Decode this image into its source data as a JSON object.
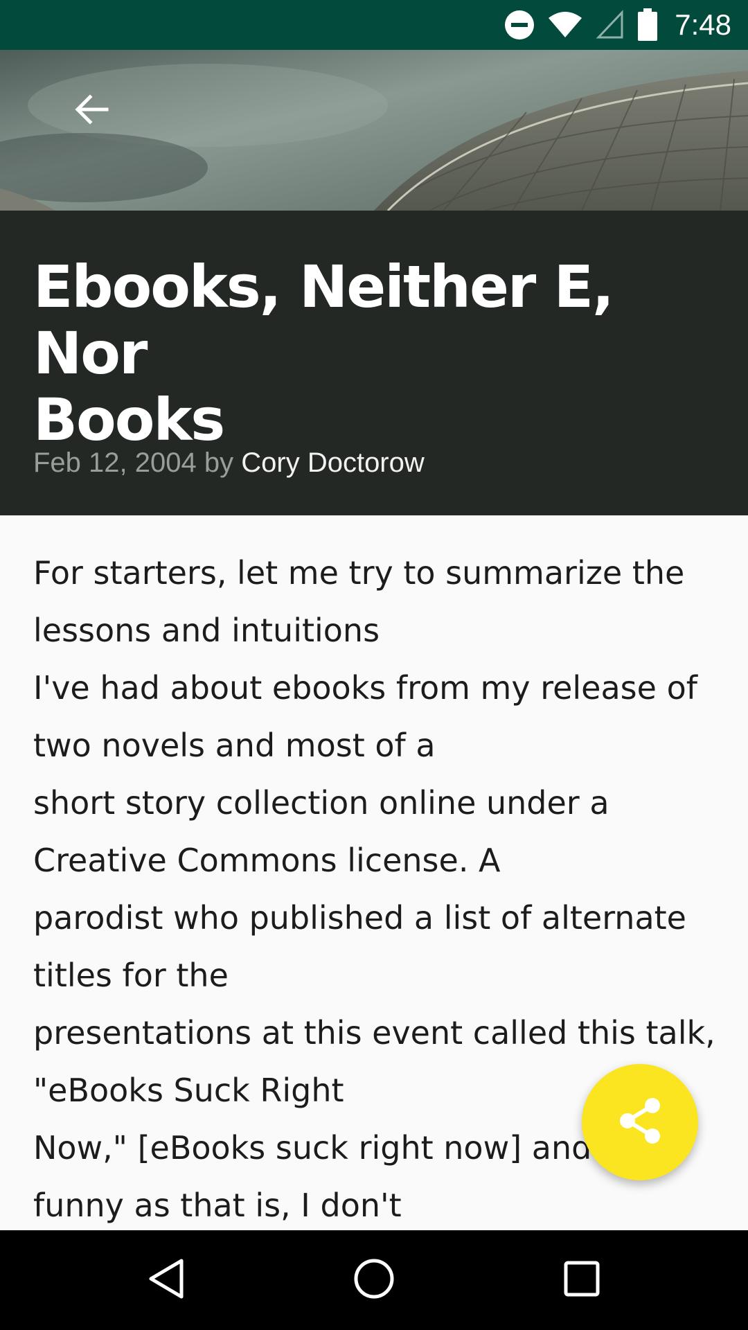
{
  "status_bar": {
    "time": "7:48",
    "background": "#024a3c",
    "icons": [
      "do-not-disturb-icon",
      "wifi-icon",
      "cell-signal-icon",
      "battery-icon"
    ]
  },
  "toolbar": {
    "back_icon": "arrow-back-icon"
  },
  "article": {
    "title_line1": "Ebooks, Neither E, Nor",
    "title_line2": "Books",
    "date": "Feb 12, 2004",
    "by": "by",
    "author": "Cory Doctorow",
    "body_lines": [
      "For starters, let me try to summarize the",
      "lessons and intuitions",
      "I've had about ebooks from my release of",
      "two novels and most of a",
      "short story collection online under a",
      "Creative Commons license. A",
      "parodist who published a list of alternate",
      "titles for the",
      "presentations at this event called this talk,",
      "\"eBooks Suck Right",
      "Now,\" [eBooks suck right now] and as",
      "funny as that is, I don't"
    ]
  },
  "fab": {
    "icon": "share-icon",
    "color": "#fbe521"
  },
  "nav_bar": {
    "icons": [
      "back-triangle-icon",
      "home-circle-icon",
      "recents-square-icon"
    ]
  },
  "colors": {
    "header_bg": "#232824",
    "body_bg": "#fafafa"
  }
}
